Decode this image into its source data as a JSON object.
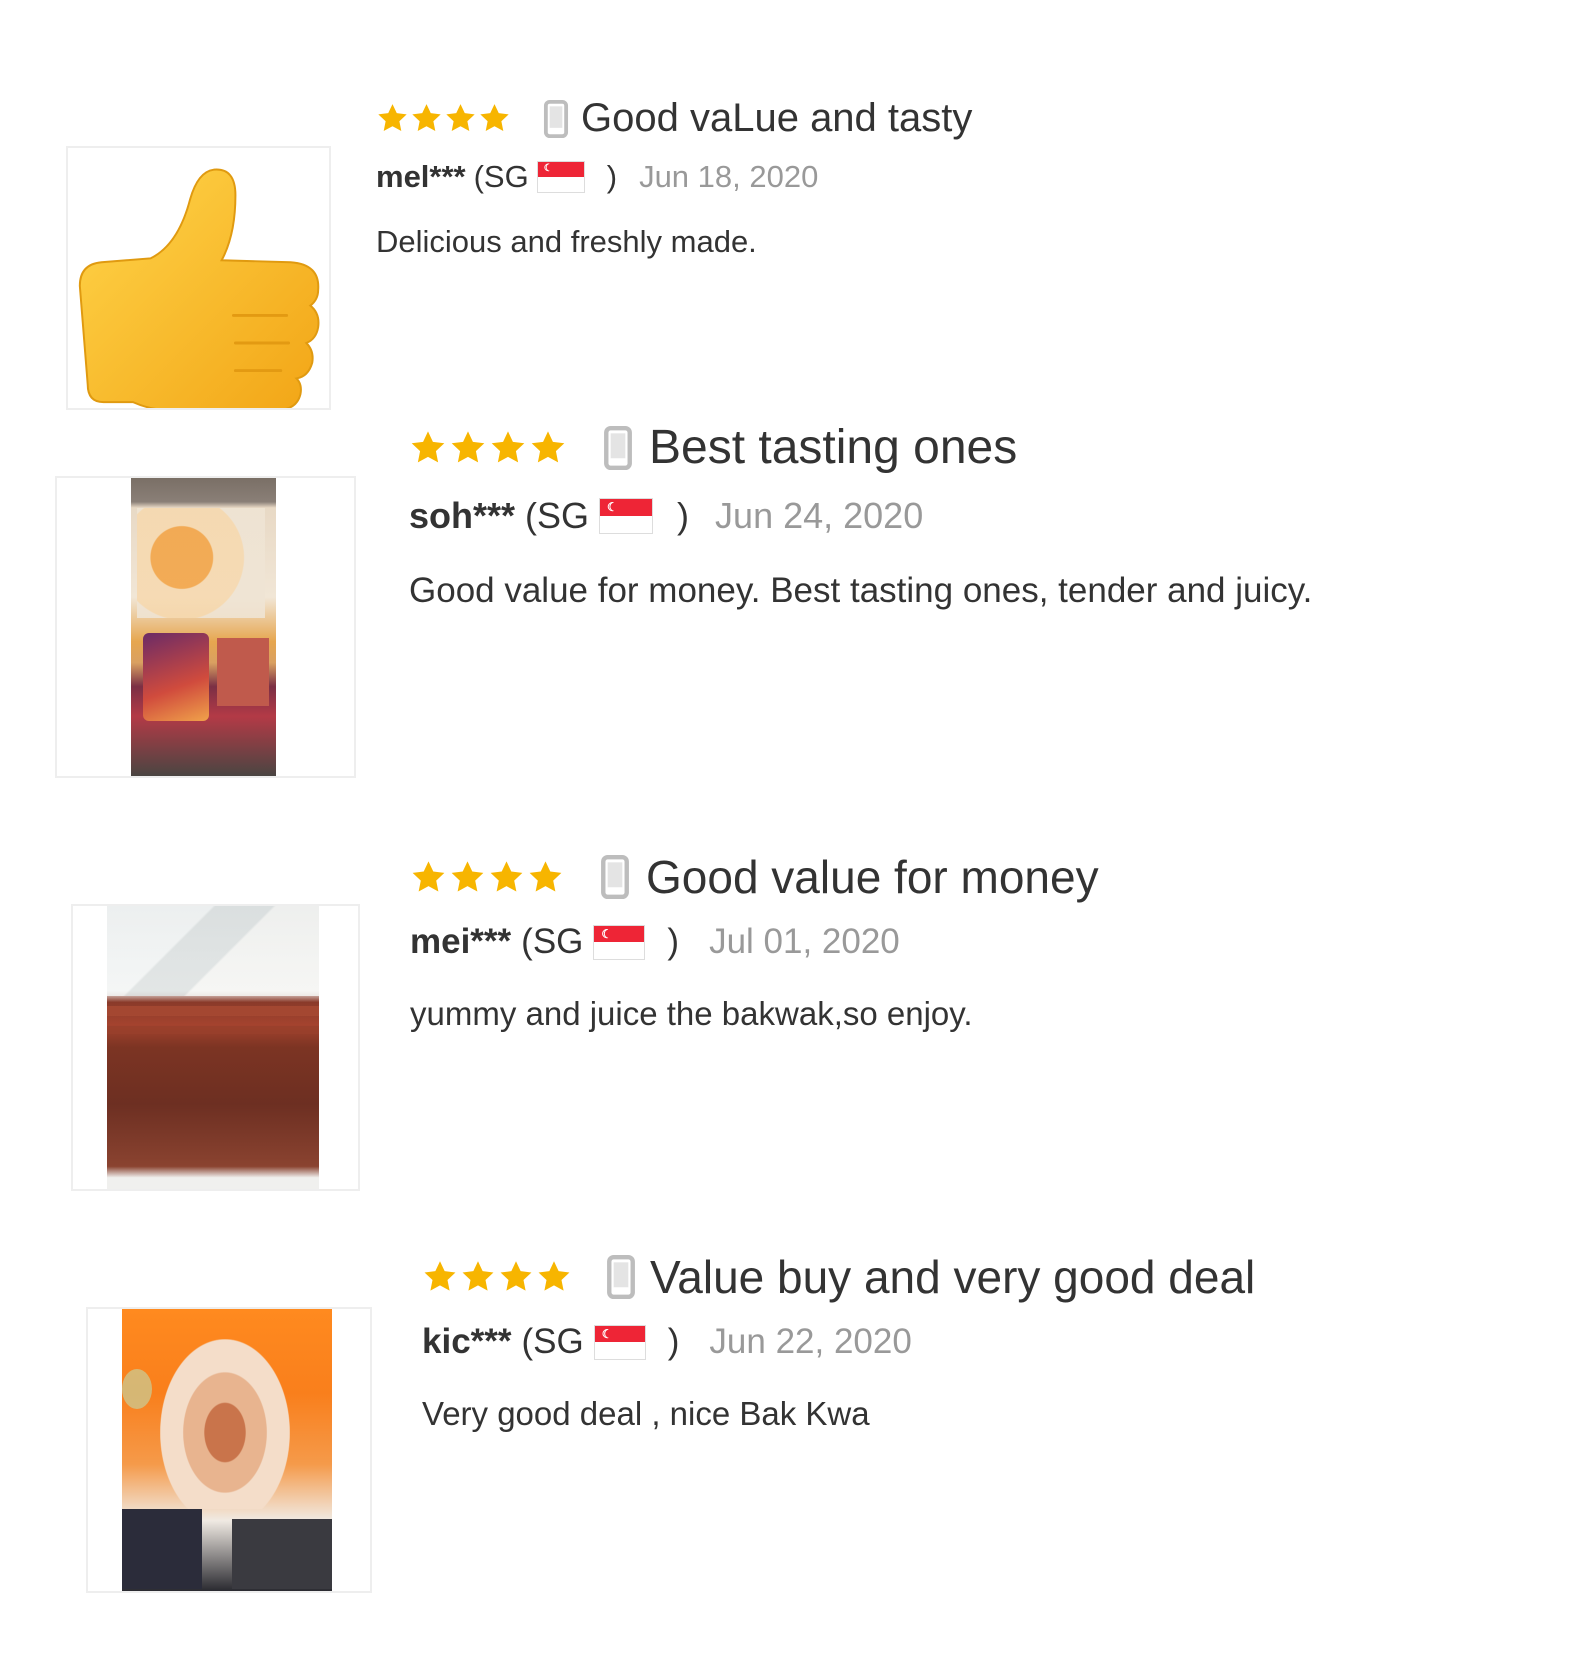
{
  "colors": {
    "star": "#f7b500",
    "date": "#999999",
    "text": "#333333",
    "flag_red": "#ee2536"
  },
  "reviews": [
    {
      "rating": 4,
      "device_icon": "mobile-phone-icon",
      "title": "Good vaLue and tasty",
      "user": "mel***",
      "country": "(SG",
      "country_flag": "singapore-flag-icon",
      "paren_close": ")",
      "date": "Jun 18, 2020",
      "text": "Delicious and freshly made.",
      "photo": "thumbs-up-emoji"
    },
    {
      "rating": 4,
      "device_icon": "mobile-phone-icon",
      "title": "Best tasting ones",
      "user": "soh***",
      "country": "(SG",
      "country_flag": "singapore-flag-icon",
      "paren_close": ")",
      "date": "Jun 24, 2020",
      "text": "Good value for money. Best tasting ones, tender and juicy.",
      "photo": "product-package-photo"
    },
    {
      "rating": 4,
      "device_icon": "mobile-phone-icon",
      "title": "Good value for money",
      "user": "mei***",
      "country": "(SG",
      "country_flag": "singapore-flag-icon",
      "paren_close": ")",
      "date": "Jul 01, 2020",
      "text": "yummy and juice the bakwak,so enjoy.",
      "photo": "bakkwa-slices-photo"
    },
    {
      "rating": 4,
      "device_icon": "mobile-phone-icon",
      "title": "Value buy and very good deal",
      "user": "kic***",
      "country": "(SG",
      "country_flag": "singapore-flag-icon",
      "paren_close": ")",
      "date": "Jun 22, 2020",
      "text": "Very good deal , nice Bak Kwa",
      "photo": "orange-bag-photo"
    }
  ]
}
